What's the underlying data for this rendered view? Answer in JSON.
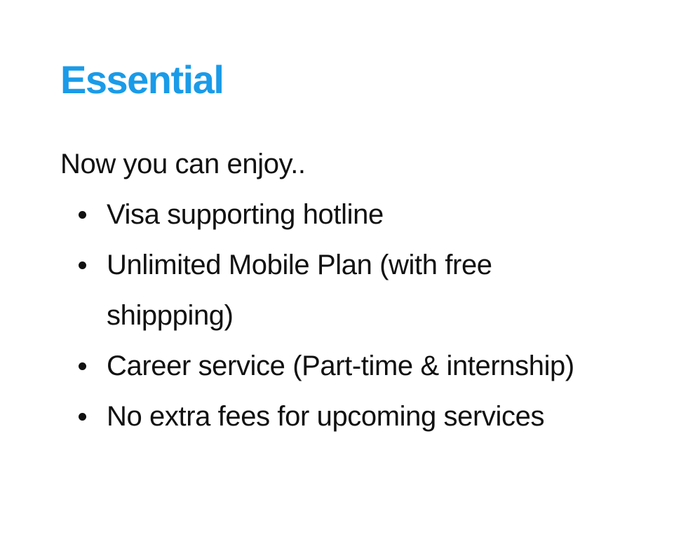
{
  "plan": {
    "title": "Essential",
    "accent_color": "#1a9be8",
    "intro": "Now you can enjoy..",
    "features": [
      "Visa supporting hotline",
      "Unlimited Mobile Plan (with free shippping)",
      "Career service (Part-time & internship)",
      "No extra fees for upcoming services"
    ]
  }
}
